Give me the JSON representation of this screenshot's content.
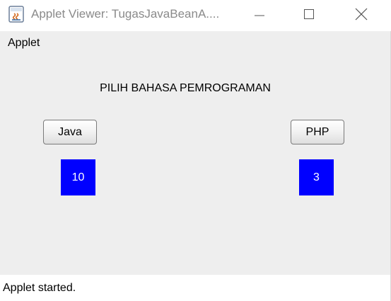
{
  "window": {
    "title": "Applet Viewer: TugasJavaBeanA....",
    "icon": "java-applet-icon"
  },
  "menubar": {
    "menu_label": "Applet"
  },
  "applet": {
    "heading": "PILIH BAHASA PEMROGRAMAN",
    "options": [
      {
        "label": "Java",
        "count": "10"
      },
      {
        "label": "PHP",
        "count": "3"
      }
    ],
    "counter_color": "#0000ff"
  },
  "status": {
    "text": "Applet started."
  }
}
